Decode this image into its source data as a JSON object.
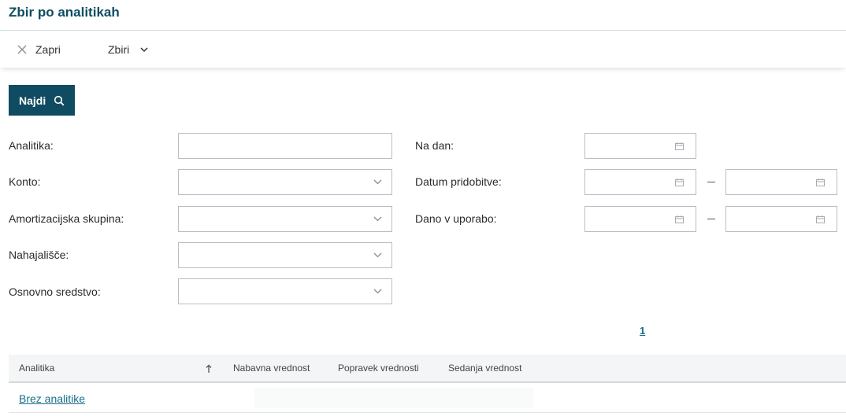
{
  "header": {
    "title": "Zbir po analitikah"
  },
  "toolbar": {
    "close_label": "Zapri",
    "menu_label": "Zbiri"
  },
  "search": {
    "button_label": "Najdi"
  },
  "filters": {
    "analitika_label": "Analitika:",
    "konto_label": "Konto:",
    "amortizacijska_label": "Amortizacijska skupina:",
    "nahajalisce_label": "Nahajališče:",
    "osnovno_label": "Osnovno sredstvo:",
    "na_dan_label": "Na dan:",
    "datum_pridobitve_label": "Datum pridobitve:",
    "dano_v_uporabo_label": "Dano v uporabo:"
  },
  "pagination": {
    "current_page": "1"
  },
  "table": {
    "columns": [
      "Analitika",
      "Nabavna vrednost",
      "Popravek vrednosti",
      "Sedanja vrednost"
    ],
    "rows": [
      {
        "analitika": "Brez analitike"
      }
    ]
  },
  "colors": {
    "primary": "#0f4c61",
    "link": "#1a6d88",
    "border": "#b9bfc4"
  },
  "icons": {
    "close": "close-icon",
    "menu": "chevron-down-icon",
    "search": "search-icon",
    "dropdown": "chevron-down-icon",
    "calendar": "calendar-icon",
    "sort": "sort-asc-icon"
  }
}
